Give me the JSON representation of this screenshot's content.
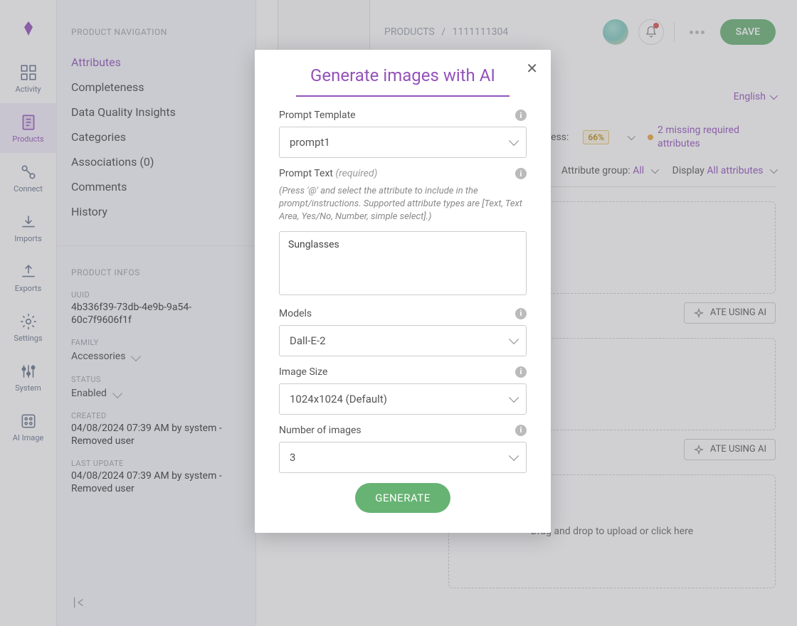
{
  "rail": {
    "items": [
      {
        "label": "Activity"
      },
      {
        "label": "Products"
      },
      {
        "label": "Connect"
      },
      {
        "label": "Imports"
      },
      {
        "label": "Exports"
      },
      {
        "label": "Settings"
      },
      {
        "label": "System"
      },
      {
        "label": "AI Image"
      }
    ],
    "active": "Products"
  },
  "navpane": {
    "heading1": "PRODUCT NAVIGATION",
    "links": [
      {
        "label": "Attributes",
        "active": true
      },
      {
        "label": "Completeness"
      },
      {
        "label": "Data Quality Insights"
      },
      {
        "label": "Categories"
      },
      {
        "label": "Associations (0)"
      },
      {
        "label": "Comments"
      },
      {
        "label": "History"
      }
    ],
    "heading2": "PRODUCT INFOS",
    "infos": {
      "uuid_label": "UUID",
      "uuid": "4b336f39-73db-4e9b-9a54-60c7f9606f1f",
      "family_label": "FAMILY",
      "family": "Accessories",
      "status_label": "STATUS",
      "status": "Enabled",
      "created_label": "CREATED",
      "created": "04/08/2024 07:39 AM by system - Removed user",
      "updated_label": "LAST UPDATE",
      "updated": "04/08/2024 07:39 AM by system - Removed user"
    }
  },
  "header": {
    "breadcrumb_root": "PRODUCTS",
    "breadcrumb_sep": "/",
    "breadcrumb_current": "1111111304",
    "save": "SAVE",
    "language": "English",
    "completeness_label": "Completeness:",
    "completeness_value": "66%",
    "missing_msg": "2 missing required attributes",
    "attr_group_label": "Attribute group:",
    "attr_group_value": "All",
    "display_label": "Display",
    "display_value": "All attributes"
  },
  "body": {
    "ai_btn": "ATE USING AI",
    "drop_hint": "Drag and drop to upload or click here"
  },
  "modal": {
    "title": "Generate images with AI",
    "template_label": "Prompt Template",
    "template_value": "prompt1",
    "prompt_label": "Prompt Text",
    "prompt_required": "(required)",
    "prompt_hint": "(Press '@' and select the attribute to include in the prompt/instructions. Supported attribute types are [Text, Text Area, Yes/No, Number, simple select].)",
    "prompt_value": "Sunglasses",
    "models_label": "Models",
    "models_value": "Dall-E-2",
    "size_label": "Image Size",
    "size_value": "1024x1024 (Default)",
    "num_label": "Number of images",
    "num_value": "3",
    "generate": "GENERATE"
  }
}
